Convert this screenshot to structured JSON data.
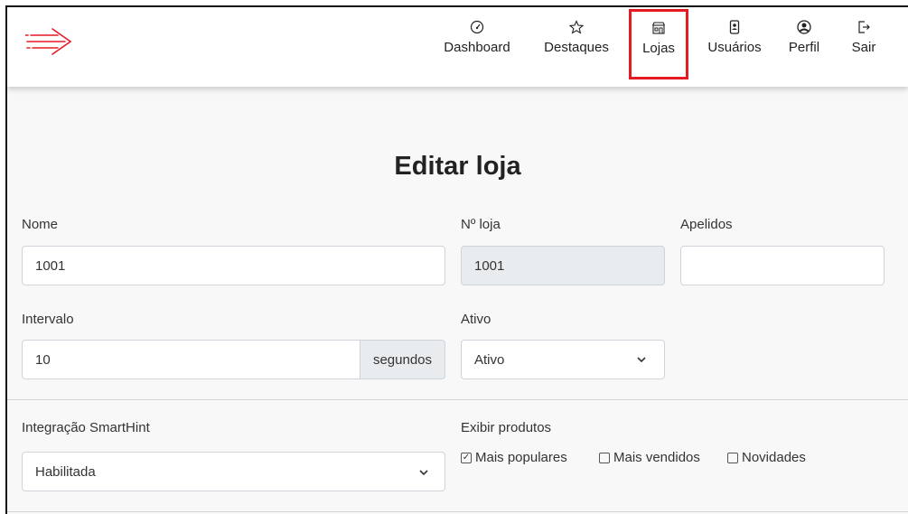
{
  "nav": {
    "items": [
      {
        "label": "Dashboard",
        "icon": "gauge-icon"
      },
      {
        "label": "Destaques",
        "icon": "star-icon"
      },
      {
        "label": "Lojas",
        "icon": "store-icon"
      },
      {
        "label": "Usuários",
        "icon": "phone-user-icon"
      },
      {
        "label": "Perfil",
        "icon": "user-circle-icon"
      },
      {
        "label": "Sair",
        "icon": "logout-icon"
      }
    ],
    "active": "Lojas",
    "accent_color": "#e41b23"
  },
  "page": {
    "title": "Editar loja"
  },
  "form": {
    "nome": {
      "label": "Nome",
      "value": "1001"
    },
    "numero": {
      "label": "Nº loja",
      "value": "1001"
    },
    "apelidos": {
      "label": "Apelidos",
      "value": ""
    },
    "intervalo": {
      "label": "Intervalo",
      "value": "10",
      "suffix": "segundos"
    },
    "ativo": {
      "label": "Ativo",
      "value": "Ativo"
    },
    "smarthint": {
      "label": "Integração SmartHint",
      "value": "Habilitada"
    },
    "exibir": {
      "label": "Exibir produtos",
      "options": [
        {
          "label": "Mais populares",
          "checked": true
        },
        {
          "label": "Mais vendidos",
          "checked": false
        },
        {
          "label": "Novidades",
          "checked": false
        }
      ]
    }
  }
}
